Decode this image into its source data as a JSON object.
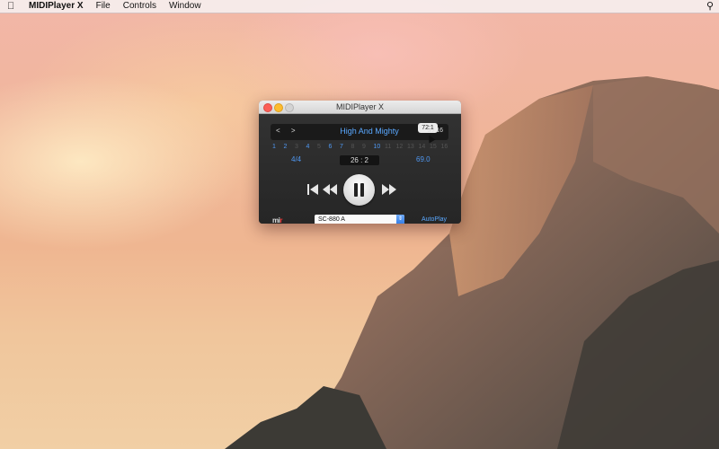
{
  "menubar": {
    "app_name": "MIDIPlayer X",
    "menus": [
      "File",
      "Controls",
      "Window"
    ]
  },
  "window": {
    "title": "MIDIPlayer X",
    "nav_label": "< >",
    "song_title": "High And Mighty",
    "track_position": "3 / 16",
    "tooltip": "72:1",
    "channels": [
      {
        "n": "1",
        "active": true
      },
      {
        "n": "2",
        "active": true
      },
      {
        "n": "3",
        "active": false
      },
      {
        "n": "4",
        "active": true
      },
      {
        "n": "5",
        "active": false
      },
      {
        "n": "6",
        "active": true
      },
      {
        "n": "7",
        "active": true
      },
      {
        "n": "8",
        "active": false
      },
      {
        "n": "9",
        "active": false
      },
      {
        "n": "10",
        "active": true
      },
      {
        "n": "11",
        "active": false
      },
      {
        "n": "12",
        "active": false
      },
      {
        "n": "13",
        "active": false
      },
      {
        "n": "14",
        "active": false
      },
      {
        "n": "15",
        "active": false
      },
      {
        "n": "16",
        "active": false
      }
    ],
    "time_signature": "4/4",
    "position": "26 : 2",
    "tempo": "69.0",
    "device": "SC-880 A",
    "autoplay_label": "AutoPlay"
  }
}
